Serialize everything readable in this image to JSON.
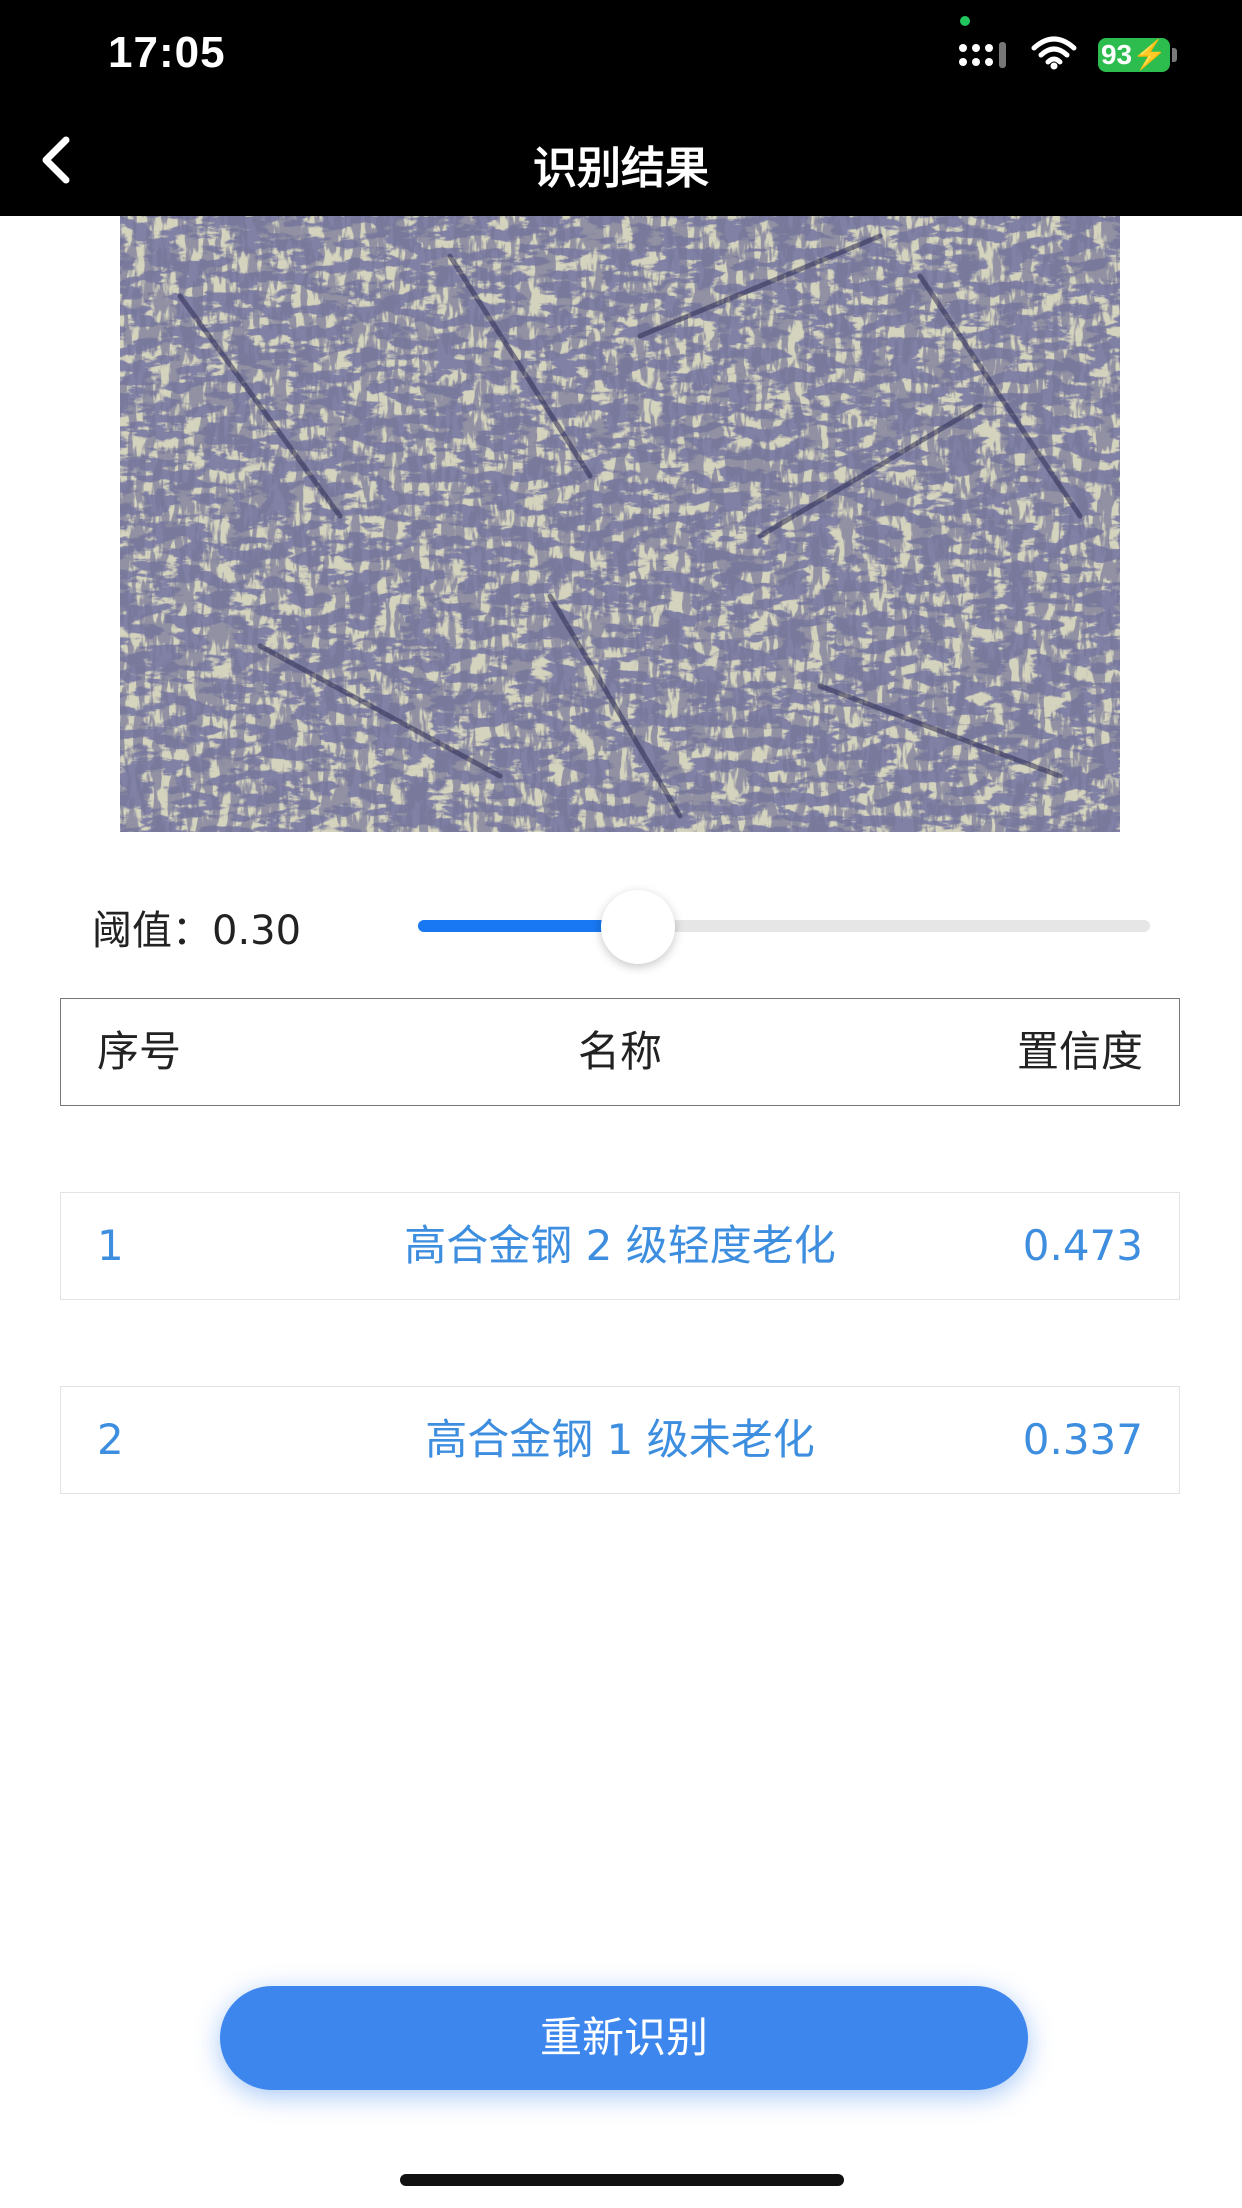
{
  "status_bar": {
    "time": "17:05",
    "battery": "93"
  },
  "nav": {
    "title": "识别结果",
    "back_icon": "chevron-left-icon"
  },
  "threshold": {
    "label": "阈值：",
    "value": "0.30",
    "level": 0.3
  },
  "table": {
    "headers": [
      "序号",
      "名称",
      "置信度"
    ],
    "rows": [
      {
        "index": "1",
        "name": "高合金钢 2 级轻度老化",
        "confidence": "0.473"
      },
      {
        "index": "2",
        "name": "高合金钢 1 级未老化",
        "confidence": "0.337"
      }
    ]
  },
  "actions": {
    "reidentify_label": "重新识别"
  },
  "colors": {
    "accent": "#3c86ee",
    "slider_fill": "#1877f2",
    "result_text": "#3e8ee0",
    "topbar": "#000000"
  }
}
